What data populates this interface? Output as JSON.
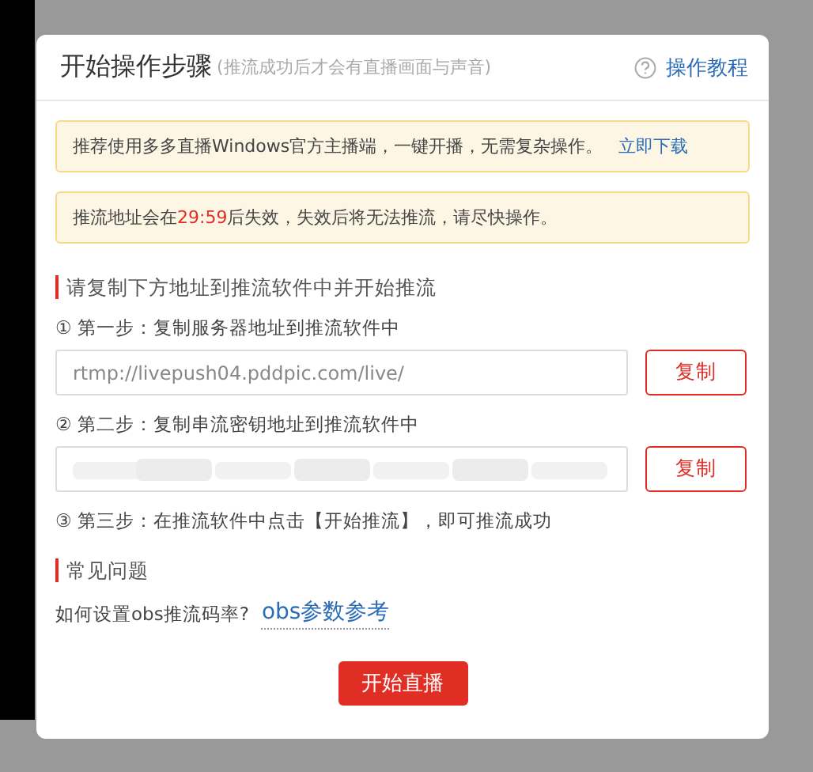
{
  "dialog": {
    "title": "开始操作步骤",
    "subtitle": "(推流成功后才会有直播画面与声音)",
    "help_link": "操作教程"
  },
  "notices": [
    {
      "kind": "link",
      "text": "推荐使用多多直播Windows官方主播端，一键开播，无需复杂操作。",
      "link": "立即下载"
    },
    {
      "kind": "countdown",
      "before": "推流地址会在",
      "time": "29:59",
      "after": "后失效，失效后将无法推流，请尽快操作。"
    }
  ],
  "section_title": "请复制下方地址到推流软件中并开始推流",
  "steps": [
    {
      "kind": "copy",
      "label": "① 第一步：复制服务器地址到推流软件中",
      "value": "rtmp://livepush04.pddpic.com/live/",
      "masked": false,
      "button": "复制"
    },
    {
      "kind": "copy",
      "label": "② 第二步：复制串流密钥地址到推流软件中",
      "masked": true,
      "button": "复制"
    },
    {
      "kind": "text",
      "label": "③ 第三步：在推流软件中点击【开始推流】，即可推流成功"
    }
  ],
  "faq": {
    "title": "常见问题",
    "question": "如何设置obs推流码率?",
    "link": "obs参数参考"
  },
  "primary_button": "开始直播"
}
